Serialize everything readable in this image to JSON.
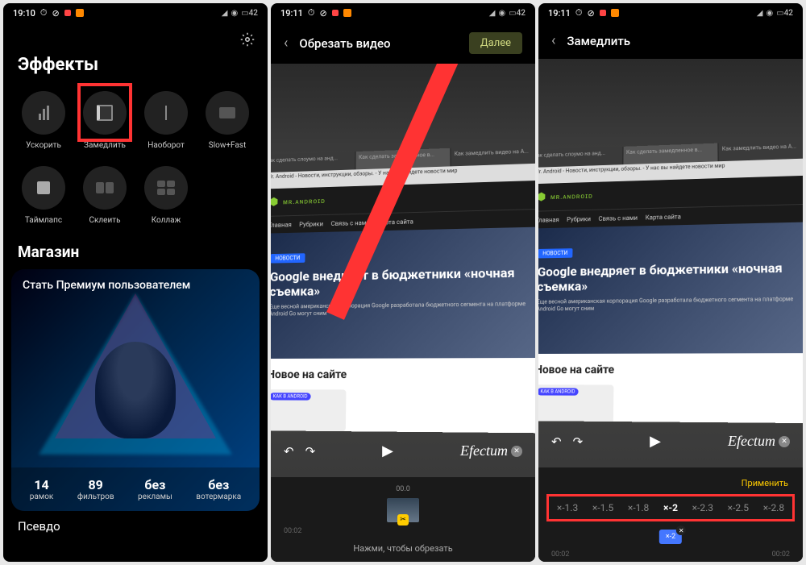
{
  "screen1": {
    "time": "19:10",
    "battery": "42",
    "title": "Эффекты",
    "effects": [
      {
        "label": "Ускорить"
      },
      {
        "label": "Замедлить"
      },
      {
        "label": "Наоборот"
      },
      {
        "label": "Slow+Fast"
      },
      {
        "label": "Таймлапс"
      },
      {
        "label": "Склеить"
      },
      {
        "label": "Коллаж"
      }
    ],
    "section2": "Магазин",
    "premium_title": "Стать Премиум пользователем",
    "stats": [
      {
        "num": "14",
        "lbl": "рамок"
      },
      {
        "num": "89",
        "lbl": "фильтров"
      },
      {
        "num": "без",
        "lbl": "рекламы"
      },
      {
        "num": "без",
        "lbl": "вотермарка"
      }
    ],
    "bottom_label": "Псевдо"
  },
  "screen2": {
    "time": "19:11",
    "battery": "42",
    "title": "Обрезать видео",
    "next": "Далее",
    "watermark": "Efectum",
    "timecode_top": "00.0",
    "timecode_left": "00:02",
    "trim_hint": "Нажми, чтобы обрезать",
    "page": {
      "tabs": [
        "Как сделать слоумо на анд...",
        "Как сделать замедленное в...",
        "Как замедлить видео на A..."
      ],
      "url": "Mr. Android - Новости, инструкции, обзоры. - У нас вы найдете новости мир",
      "logo": "ᴍʀ.ᴀɴᴅʀᴏɪᴅ",
      "nav": [
        "Главная",
        "Рубрики",
        "Связь с нами",
        "Карта сайта"
      ],
      "news_badge": "НОВОСТИ",
      "hero_title": "Google внедряет в бюджетники «ночная съемка»",
      "hero_sub": "Еще весной американская корпорация Google разработала бюджетного сегмента на платформе Android Go могут сним",
      "section": "Новое на сайте",
      "card_badge": "КАК В ANDROID"
    }
  },
  "screen3": {
    "time": "19:11",
    "battery": "42",
    "title": "Замедлить",
    "watermark": "Efectum",
    "apply": "Применить",
    "speeds": [
      "×-1.3",
      "×-1.5",
      "×-1.8",
      "×-2",
      "×-2.3",
      "×-2.5",
      "×-2.8"
    ],
    "speed_active": "×-2",
    "marker": "×-2",
    "timecode_left": "00:02",
    "timecode_right": "00:02"
  }
}
